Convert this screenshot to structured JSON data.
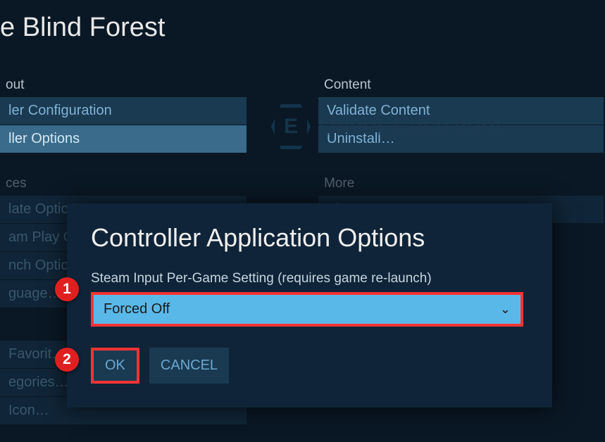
{
  "title_partial": "e Blind Forest",
  "left": {
    "section1_header": "out",
    "section1_items": [
      "ler Configuration",
      "ller Options"
    ],
    "section1_selected_index": 1,
    "section2_header": "ces",
    "section2_items": [
      "late Options",
      "am Play O",
      "nch Optio",
      "guage…"
    ],
    "section3_items": [
      "Favorit…",
      "egories…",
      "Icon…"
    ]
  },
  "right": {
    "content_header": "Content",
    "content_items": [
      "Validate Content",
      "Uninstall…"
    ],
    "more_header": "More",
    "more_items": [
      "View Store Page"
    ]
  },
  "watermark_text": "Driver Easy.com",
  "modal": {
    "title": "Controller Application Options",
    "label": "Steam Input Per-Game Setting (requires game re-launch)",
    "dropdown_value": "Forced Off",
    "ok_label": "OK",
    "cancel_label": "CANCEL"
  },
  "annotations": {
    "badge1": "1",
    "badge2": "2"
  }
}
